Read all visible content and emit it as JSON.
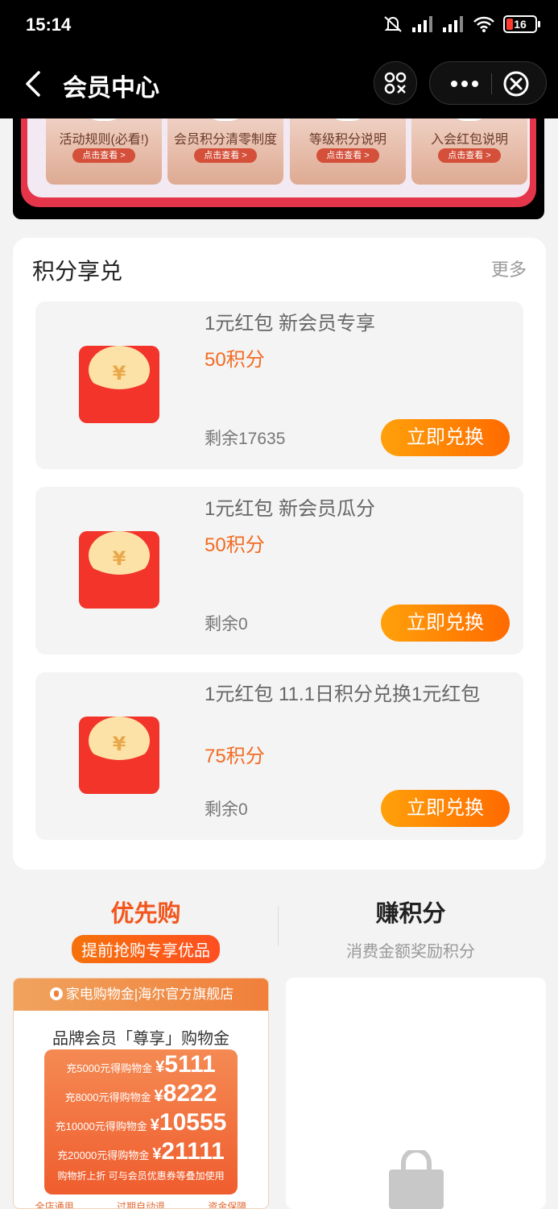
{
  "status_bar": {
    "time": "15:14",
    "battery": "16"
  },
  "nav": {
    "title": "会员中心"
  },
  "banner": {
    "cards": [
      {
        "title": "活动规则(必看!)",
        "button": "点击查看 >"
      },
      {
        "title": "会员积分清零制度",
        "button": "点击查看 >"
      },
      {
        "title": "等级积分说明",
        "button": "点击查看 >"
      },
      {
        "title": "入会红包说明",
        "button": "点击查看 >"
      }
    ]
  },
  "exchange": {
    "title": "积分享兑",
    "more": "更多",
    "items": [
      {
        "title": "1元红包 新会员专享",
        "points": "50积分",
        "remain": "剩余17635",
        "button": "立即兑换"
      },
      {
        "title": "1元红包 新会员瓜分",
        "points": "50积分",
        "remain": "剩余0",
        "button": "立即兑换"
      },
      {
        "title": "1元红包 11.1日积分兑换1元红包",
        "points": "75积分",
        "remain": "剩余0",
        "button": "立即兑换"
      }
    ]
  },
  "tabs": [
    {
      "title": "优先购",
      "subtitle": "提前抢购专享优品"
    },
    {
      "title": "赚积分",
      "subtitle": "消费金额奖励积分"
    }
  ],
  "promo": {
    "header": "家电购物金|海尔官方旗舰店",
    "subtitle": "品牌会员「尊享」购物金",
    "rows": [
      {
        "text": "充5000元得购物金",
        "yen": "¥",
        "amount": "5111"
      },
      {
        "text": "充8000元得购物金",
        "yen": "¥",
        "amount": "8222"
      },
      {
        "text": "充10000元得购物金",
        "yen": "¥",
        "amount": "10555"
      },
      {
        "text": "充20000元得购物金",
        "yen": "¥",
        "amount": "21111"
      }
    ],
    "note": "购物折上折 可与会员优惠券等叠加使用",
    "features": [
      "全店通用",
      "过期自动退",
      "资金保障"
    ]
  },
  "colors": {
    "accent": "#f26b22",
    "button_start": "#ffa10a",
    "button_end": "#ff6a00",
    "banner_red": "#e5354a"
  }
}
